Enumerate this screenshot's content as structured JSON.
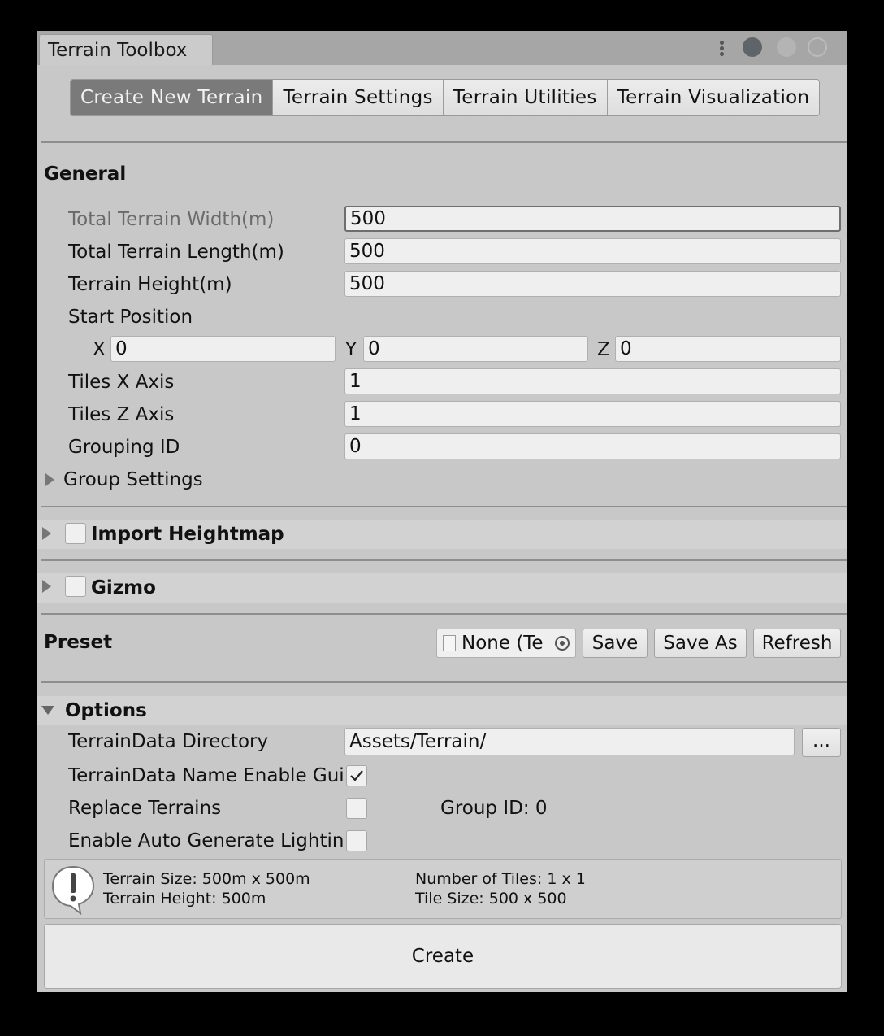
{
  "window": {
    "tab_title": "Terrain Toolbox"
  },
  "toolbar": {
    "tabs": [
      {
        "label": "Create New Terrain",
        "active": true
      },
      {
        "label": "Terrain Settings",
        "active": false
      },
      {
        "label": "Terrain Utilities",
        "active": false
      },
      {
        "label": "Terrain Visualization",
        "active": false
      }
    ]
  },
  "general": {
    "title": "General",
    "total_width_label": "Total Terrain Width(m)",
    "total_width_value": "500",
    "total_length_label": "Total Terrain Length(m)",
    "total_length_value": "500",
    "height_label": "Terrain Height(m)",
    "height_value": "500",
    "start_position_label": "Start Position",
    "x_label": "X",
    "x_value": "0",
    "y_label": "Y",
    "y_value": "0",
    "z_label": "Z",
    "z_value": "0",
    "tiles_x_label": "Tiles X Axis",
    "tiles_x_value": "1",
    "tiles_z_label": "Tiles Z Axis",
    "tiles_z_value": "1",
    "grouping_id_label": "Grouping ID",
    "grouping_id_value": "0",
    "group_settings_label": "Group Settings"
  },
  "import_heightmap": {
    "label": "Import Heightmap",
    "enabled": false
  },
  "gizmo": {
    "label": "Gizmo",
    "enabled": false
  },
  "preset": {
    "title": "Preset",
    "object_field_value": "None (Te",
    "save_label": "Save",
    "save_as_label": "Save As",
    "refresh_label": "Refresh"
  },
  "options": {
    "title": "Options",
    "directory_label": "TerrainData Directory",
    "directory_value": "Assets/Terrain/",
    "browse_label": "...",
    "name_guid_label": "TerrainData Name Enable Guid",
    "name_guid_checked": true,
    "replace_label": "Replace Terrains",
    "replace_checked": false,
    "group_id_text": "Group ID: 0",
    "auto_lighting_label": "Enable Auto Generate Lighting",
    "auto_lighting_checked": false
  },
  "summary": {
    "icon": "warning-icon",
    "terrain_size": "Terrain Size: 500m x 500m",
    "terrain_height": "Terrain Height: 500m",
    "num_tiles": "Number of Tiles: 1 x 1",
    "tile_size": "Tile Size: 500 x 500"
  },
  "create_label": "Create"
}
